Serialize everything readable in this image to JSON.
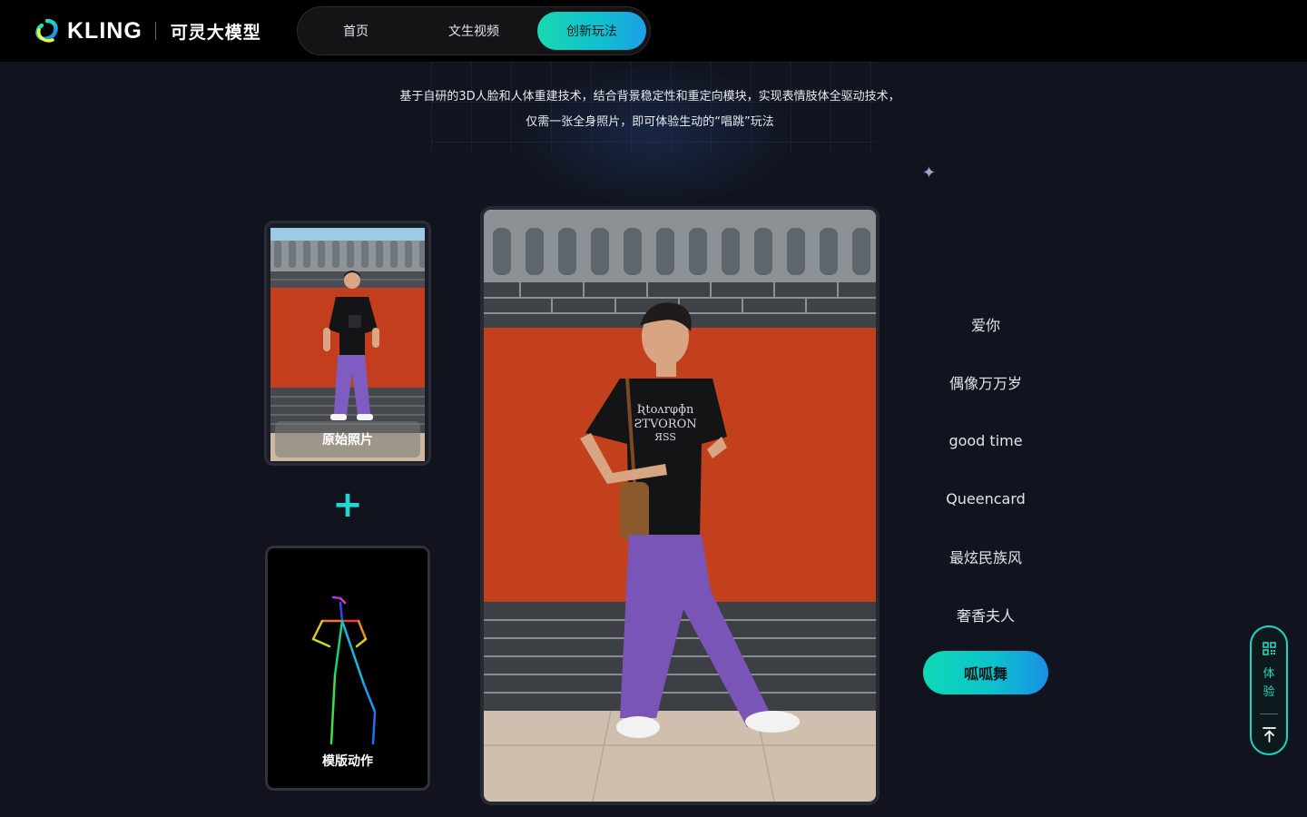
{
  "header": {
    "logo_word": "KLING",
    "logo_cn": "可灵大模型",
    "nav": [
      {
        "label": "首页",
        "active": false
      },
      {
        "label": "文生视频",
        "active": false
      },
      {
        "label": "创新玩法",
        "active": true
      }
    ]
  },
  "intro": {
    "line1": "基于自研的3D人脸和人体重建技术，结合背景稳定性和重定向模块，实现表情肢体全驱动技术，",
    "line2": "仅需一张全身照片，即可体验生动的“唱跳”玩法"
  },
  "left_cards": {
    "original_label": "原始照片",
    "plus_symbol": "+",
    "template_label": "模版动作"
  },
  "dances": [
    {
      "label": "爱你",
      "active": false
    },
    {
      "label": "偶像万万岁",
      "active": false
    },
    {
      "label": "good time",
      "active": false
    },
    {
      "label": "Queencard",
      "active": false
    },
    {
      "label": "最炫民族风",
      "active": false
    },
    {
      "label": "奢香夫人",
      "active": false
    },
    {
      "label": "呱呱舞",
      "active": true
    }
  ],
  "side_widget": {
    "try_line1": "体",
    "try_line2": "验",
    "icons": [
      "qr-code-icon",
      "back-to-top-icon"
    ]
  },
  "colors": {
    "accent_start": "#18d8b0",
    "accent_end": "#1d9fe6",
    "page_bg": "#11141f",
    "header_bg": "#000000"
  }
}
